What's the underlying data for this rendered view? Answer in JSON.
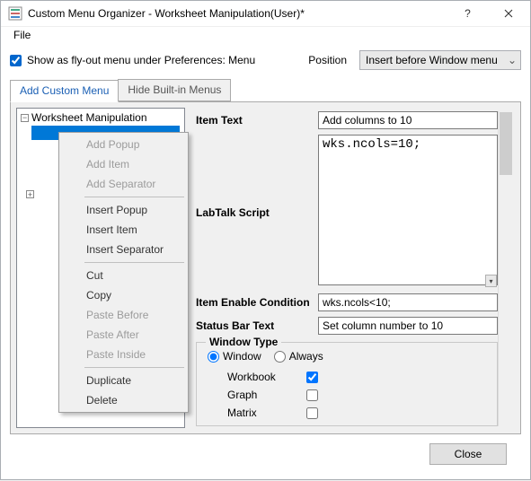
{
  "titlebar": {
    "title": "Custom Menu Organizer - Worksheet Manipulation(User)*",
    "icon_name": "app-icon"
  },
  "menubar": {
    "file": "File"
  },
  "options": {
    "flyout_label": "Show as fly-out menu under Preferences: Menu",
    "flyout_checked": true,
    "position_label": "Position",
    "position_value": "Insert before Window menu"
  },
  "tabs": {
    "add_custom": "Add Custom Menu",
    "hide_builtin": "Hide Built-in Menus",
    "active": "add_custom"
  },
  "tree": {
    "root": "Worksheet Manipulation"
  },
  "context_menu": {
    "add_popup": "Add Popup",
    "add_item": "Add Item",
    "add_separator": "Add Separator",
    "insert_popup": "Insert Popup",
    "insert_item": "Insert Item",
    "insert_separator": "Insert Separator",
    "cut": "Cut",
    "copy": "Copy",
    "paste_before": "Paste Before",
    "paste_after": "Paste After",
    "paste_inside": "Paste Inside",
    "duplicate": "Duplicate",
    "delete": "Delete"
  },
  "form": {
    "item_text_label": "Item Text",
    "item_text_value": "Add columns to 10",
    "script_label": "LabTalk Script",
    "script_value": "wks.ncols=10;",
    "enable_label": "Item Enable Condition",
    "enable_value": "wks.ncols<10;",
    "status_label": "Status Bar Text",
    "status_value": "Set column number to 10",
    "window_type_label": "Window Type",
    "radio_window": "Window",
    "radio_always": "Always",
    "radio_selected": "window",
    "workbook_label": "Workbook",
    "workbook_checked": true,
    "graph_label": "Graph",
    "graph_checked": false,
    "matrix_label": "Matrix",
    "matrix_checked": false
  },
  "footer": {
    "close": "Close"
  }
}
